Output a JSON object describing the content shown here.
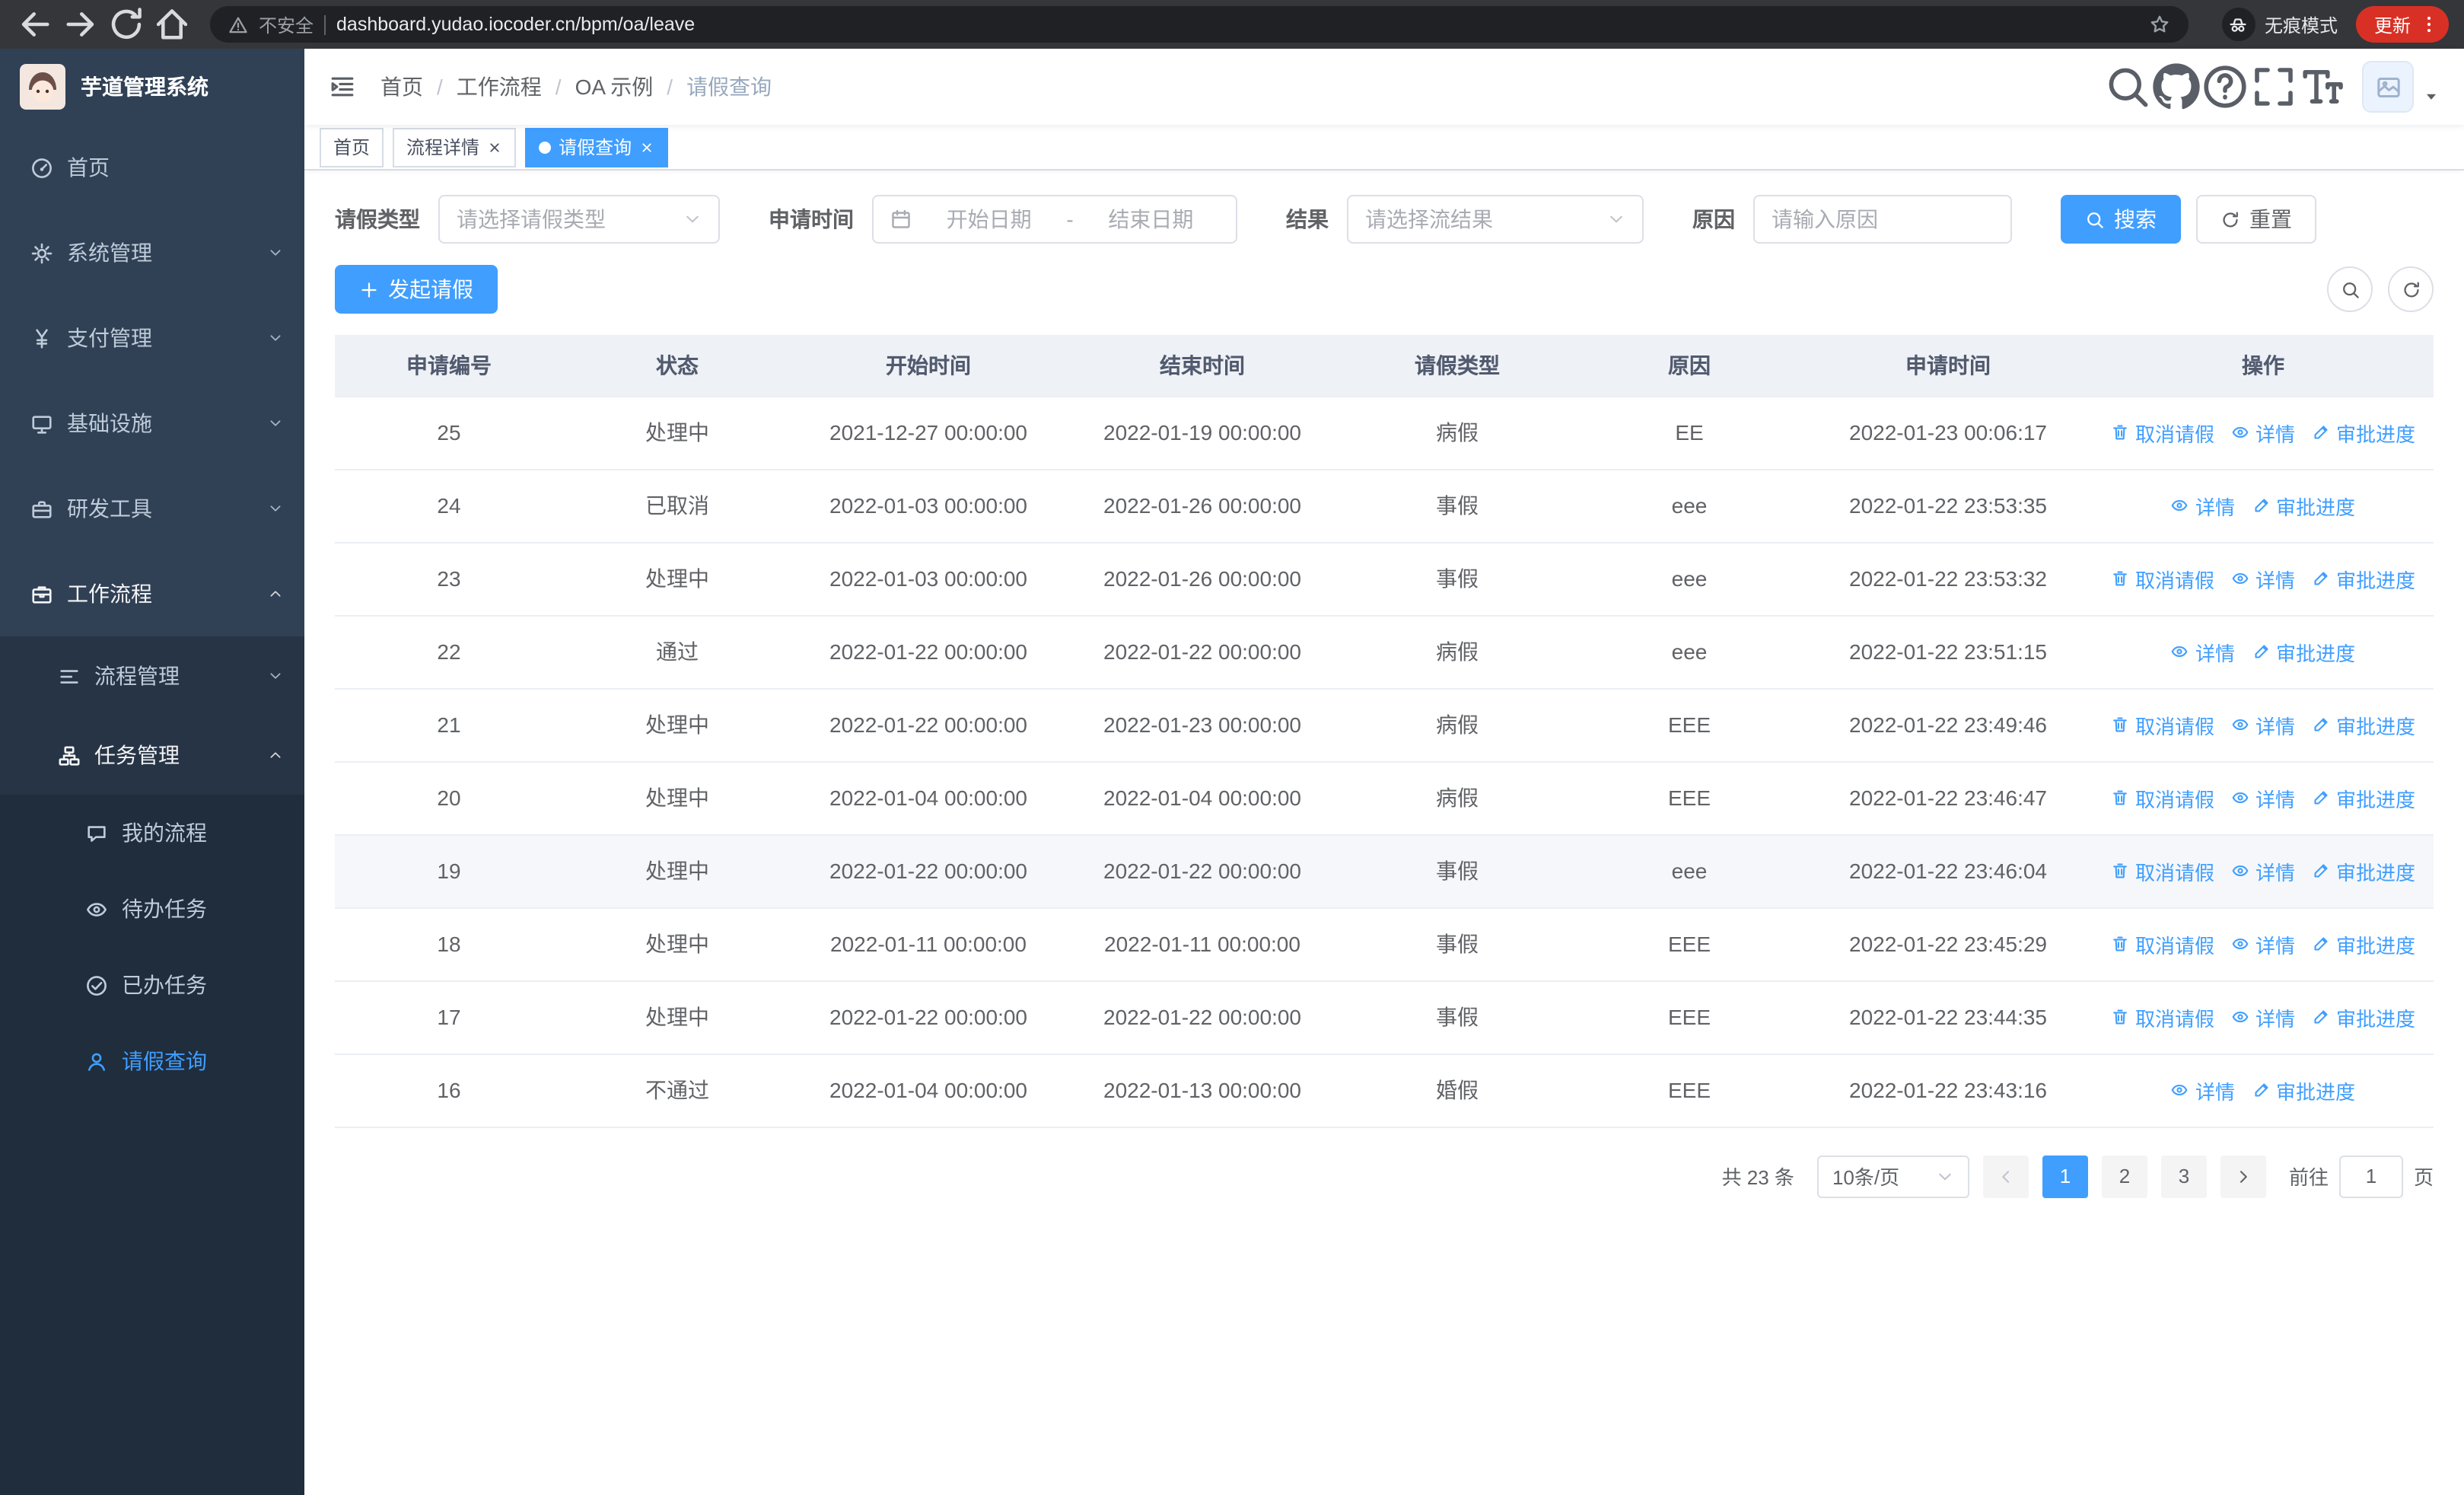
{
  "browser": {
    "nav_icons": [
      {
        "name": "back-icon",
        "disabled": false
      },
      {
        "name": "forward-icon",
        "disabled": false
      },
      {
        "name": "reload-icon",
        "disabled": false
      },
      {
        "name": "home-icon",
        "disabled": false
      }
    ],
    "security_label": "不安全",
    "url": "dashboard.yudao.iocoder.cn/bpm/oa/leave",
    "incognito_label": "无痕模式",
    "update_label": "更新"
  },
  "sidebar": {
    "logo_title": "芋道管理系统",
    "menu": [
      {
        "key": "home",
        "label": "首页",
        "icon": "dashboard-icon",
        "level": 1
      },
      {
        "key": "system",
        "label": "系统管理",
        "icon": "gear-icon",
        "level": 1,
        "arrow": "down"
      },
      {
        "key": "payment",
        "label": "支付管理",
        "icon": "yen-icon",
        "level": 1,
        "arrow": "down"
      },
      {
        "key": "infrastructure",
        "label": "基础设施",
        "icon": "monitor-icon",
        "level": 1,
        "arrow": "down"
      },
      {
        "key": "dev-tools",
        "label": "研发工具",
        "icon": "toolbox-icon",
        "level": 1,
        "arrow": "down"
      },
      {
        "key": "workflow",
        "label": "工作流程",
        "icon": "briefcase-icon",
        "level": 1,
        "arrow": "up",
        "open": true
      },
      {
        "key": "process-mgmt",
        "label": "流程管理",
        "icon": "list-icon",
        "level": 2,
        "arrow": "down"
      },
      {
        "key": "task-mgmt",
        "label": "任务管理",
        "icon": "org-icon",
        "level": 2,
        "arrow": "up",
        "open": true
      },
      {
        "key": "my-process",
        "label": "我的流程",
        "icon": "chat-icon",
        "level": 3
      },
      {
        "key": "todo-task",
        "label": "待办任务",
        "icon": "eye-icon",
        "level": 3
      },
      {
        "key": "done-task",
        "label": "已办任务",
        "icon": "check-circle-icon",
        "level": 3
      },
      {
        "key": "leave-query",
        "label": "请假查询",
        "icon": "user-icon",
        "level": 3,
        "active": true
      }
    ]
  },
  "header": {
    "breadcrumb": [
      "首页",
      "工作流程",
      "OA 示例",
      "请假查询"
    ],
    "tools": [
      "search-icon",
      "github-icon",
      "question-icon",
      "fullscreen-icon",
      "font-size-icon"
    ]
  },
  "tabs": [
    {
      "key": "home",
      "label": "首页",
      "closable": false,
      "active": false
    },
    {
      "key": "process-detail",
      "label": "流程详情",
      "closable": true,
      "active": false
    },
    {
      "key": "leave-query",
      "label": "请假查询",
      "closable": true,
      "active": true
    }
  ],
  "filters": {
    "leave_type_label": "请假类型",
    "leave_type_placeholder": "请选择请假类型",
    "apply_time_label": "申请时间",
    "start_placeholder": "开始日期",
    "range_separator": "-",
    "end_placeholder": "结束日期",
    "result_label": "结果",
    "result_placeholder": "请选择流结果",
    "reason_label": "原因",
    "reason_placeholder": "请输入原因",
    "search_button": "搜索",
    "reset_button": "重置"
  },
  "toolbar": {
    "create_button": "发起请假"
  },
  "table": {
    "columns": [
      "申请编号",
      "状态",
      "开始时间",
      "结束时间",
      "请假类型",
      "原因",
      "申请时间",
      "操作"
    ],
    "action_defs": {
      "cancel": {
        "label": "取消请假",
        "icon": "delete-icon"
      },
      "detail": {
        "label": "详情",
        "icon": "view-icon"
      },
      "progress": {
        "label": "审批进度",
        "icon": "edit-icon"
      }
    },
    "rows": [
      {
        "id": "25",
        "status": "处理中",
        "start_time": "2021-12-27 00:00:00",
        "end_time": "2022-01-19 00:00:00",
        "leave_type": "病假",
        "reason": "EE",
        "apply_time": "2022-01-23 00:06:17",
        "actions": [
          "cancel",
          "detail",
          "progress"
        ],
        "hovered": false
      },
      {
        "id": "24",
        "status": "已取消",
        "start_time": "2022-01-03 00:00:00",
        "end_time": "2022-01-26 00:00:00",
        "leave_type": "事假",
        "reason": "eee",
        "apply_time": "2022-01-22 23:53:35",
        "actions": [
          "detail",
          "progress"
        ],
        "hovered": false
      },
      {
        "id": "23",
        "status": "处理中",
        "start_time": "2022-01-03 00:00:00",
        "end_time": "2022-01-26 00:00:00",
        "leave_type": "事假",
        "reason": "eee",
        "apply_time": "2022-01-22 23:53:32",
        "actions": [
          "cancel",
          "detail",
          "progress"
        ],
        "hovered": false
      },
      {
        "id": "22",
        "status": "通过",
        "start_time": "2022-01-22 00:00:00",
        "end_time": "2022-01-22 00:00:00",
        "leave_type": "病假",
        "reason": "eee",
        "apply_time": "2022-01-22 23:51:15",
        "actions": [
          "detail",
          "progress"
        ],
        "hovered": false
      },
      {
        "id": "21",
        "status": "处理中",
        "start_time": "2022-01-22 00:00:00",
        "end_time": "2022-01-23 00:00:00",
        "leave_type": "病假",
        "reason": "EEE",
        "apply_time": "2022-01-22 23:49:46",
        "actions": [
          "cancel",
          "detail",
          "progress"
        ],
        "hovered": false
      },
      {
        "id": "20",
        "status": "处理中",
        "start_time": "2022-01-04 00:00:00",
        "end_time": "2022-01-04 00:00:00",
        "leave_type": "病假",
        "reason": "EEE",
        "apply_time": "2022-01-22 23:46:47",
        "actions": [
          "cancel",
          "detail",
          "progress"
        ],
        "hovered": false
      },
      {
        "id": "19",
        "status": "处理中",
        "start_time": "2022-01-22 00:00:00",
        "end_time": "2022-01-22 00:00:00",
        "leave_type": "事假",
        "reason": "eee",
        "apply_time": "2022-01-22 23:46:04",
        "actions": [
          "cancel",
          "detail",
          "progress"
        ],
        "hovered": true
      },
      {
        "id": "18",
        "status": "处理中",
        "start_time": "2022-01-11 00:00:00",
        "end_time": "2022-01-11 00:00:00",
        "leave_type": "事假",
        "reason": "EEE",
        "apply_time": "2022-01-22 23:45:29",
        "actions": [
          "cancel",
          "detail",
          "progress"
        ],
        "hovered": false
      },
      {
        "id": "17",
        "status": "处理中",
        "start_time": "2022-01-22 00:00:00",
        "end_time": "2022-01-22 00:00:00",
        "leave_type": "事假",
        "reason": "EEE",
        "apply_time": "2022-01-22 23:44:35",
        "actions": [
          "cancel",
          "detail",
          "progress"
        ],
        "hovered": false
      },
      {
        "id": "16",
        "status": "不通过",
        "start_time": "2022-01-04 00:00:00",
        "end_time": "2022-01-13 00:00:00",
        "leave_type": "婚假",
        "reason": "EEE",
        "apply_time": "2022-01-22 23:43:16",
        "actions": [
          "detail",
          "progress"
        ],
        "hovered": false
      }
    ]
  },
  "pagination": {
    "total_label": "共 23 条",
    "page_size_label": "10条/页",
    "pages": [
      "1",
      "2",
      "3"
    ],
    "active_page": "1",
    "goto_label": "前往",
    "goto_value": "1",
    "goto_unit_label": "页"
  },
  "colors": {
    "primary": "#409eff",
    "sidebar_bg": "#304156",
    "sidebar_sub_bg": "#1f2d3d",
    "sidebar_text": "#bfcbd9"
  }
}
